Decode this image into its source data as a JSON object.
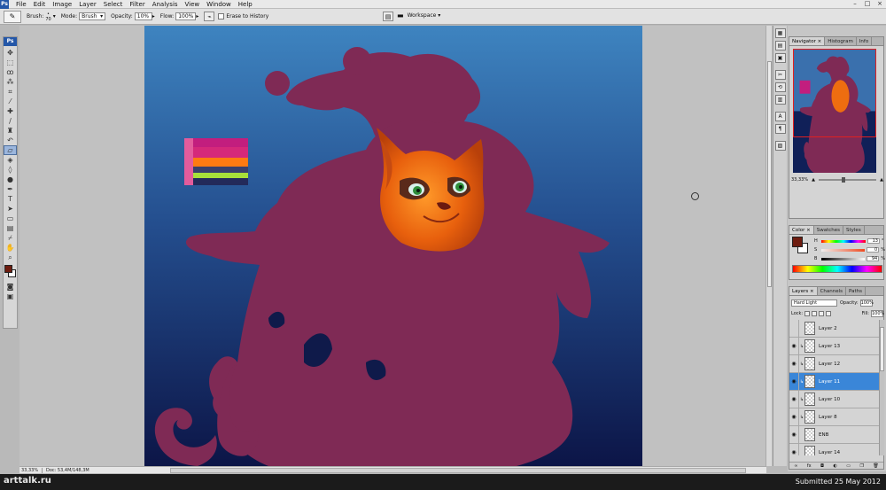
{
  "menubar": {
    "logo": "Ps",
    "items": [
      "File",
      "Edit",
      "Image",
      "Layer",
      "Select",
      "Filter",
      "Analysis",
      "View",
      "Window",
      "Help"
    ],
    "window_controls": [
      "–",
      "□",
      "×"
    ]
  },
  "options": {
    "brush_label": "Brush:",
    "brush_size": "70",
    "mode_label": "Mode:",
    "mode_value": "Brush",
    "opacity_label": "Opacity:",
    "opacity_value": "10%",
    "flow_label": "Flow:",
    "flow_value": "100%",
    "erase_label": "Erase to History",
    "workspace_label": "Workspace ▾"
  },
  "toolbox": {
    "badge": "Ps",
    "tools": [
      "move-icon",
      "marquee-icon",
      "lasso-icon",
      "magic-wand-icon",
      "crop-icon",
      "eyedropper-icon",
      "healing-icon",
      "brush-icon",
      "clone-stamp-icon",
      "history-brush-icon",
      "eraser-icon",
      "paint-bucket-icon",
      "blur-icon",
      "dodge-icon",
      "pen-icon",
      "type-icon",
      "path-select-icon",
      "shape-icon",
      "notes-icon",
      "eyedropper2-icon",
      "hand-icon",
      "zoom-icon"
    ],
    "active_tool": "eraser-icon"
  },
  "status": {
    "zoom": "33,33%",
    "doc": "Doc: 53,4M/148,3M"
  },
  "navigator": {
    "tabs": [
      "Navigator ×",
      "Histogram",
      "Info"
    ],
    "zoom": "33,33%"
  },
  "color_panel": {
    "tabs": [
      "Color ×",
      "Swatches",
      "Styles"
    ],
    "rows": [
      {
        "label": "H",
        "value": "13",
        "unit": "°"
      },
      {
        "label": "S",
        "value": "0",
        "unit": "%"
      },
      {
        "label": "B",
        "value": "94",
        "unit": "%"
      }
    ]
  },
  "layers_panel": {
    "tabs": [
      "Layers ×",
      "Channels",
      "Paths"
    ],
    "blend_mode": "Hard Light",
    "opacity_label": "Opacity:",
    "opacity_value": "100%",
    "lock_label": "Lock:",
    "fill_label": "Fill:",
    "fill_value": "100%",
    "layers": [
      {
        "name": "Layer 2",
        "visible": false,
        "linked": false,
        "selected": false
      },
      {
        "name": "Layer 13",
        "visible": true,
        "linked": true,
        "selected": false
      },
      {
        "name": "Layer 12",
        "visible": true,
        "linked": true,
        "selected": false
      },
      {
        "name": "Layer 11",
        "visible": true,
        "linked": true,
        "selected": true
      },
      {
        "name": "Layer 10",
        "visible": true,
        "linked": true,
        "selected": false
      },
      {
        "name": "Layer 8",
        "visible": true,
        "linked": true,
        "selected": false
      },
      {
        "name": "ENB",
        "visible": true,
        "linked": false,
        "selected": false
      },
      {
        "name": "Layer 14",
        "visible": true,
        "linked": false,
        "selected": false
      }
    ],
    "footer_icons": [
      "link-icon",
      "fx-icon",
      "mask-icon",
      "adjustment-icon",
      "folder-icon",
      "new-layer-icon",
      "trash-icon"
    ]
  },
  "footer": {
    "brand": "arttalk.ru",
    "submitted": "Submitted 25 May 2012"
  },
  "colors": {
    "silhouette": "#7f2a55",
    "sky_top": "#3e84c0",
    "sky_bottom": "#0c1547",
    "fur": "#ee6d10",
    "accent": "#3a86d8"
  }
}
